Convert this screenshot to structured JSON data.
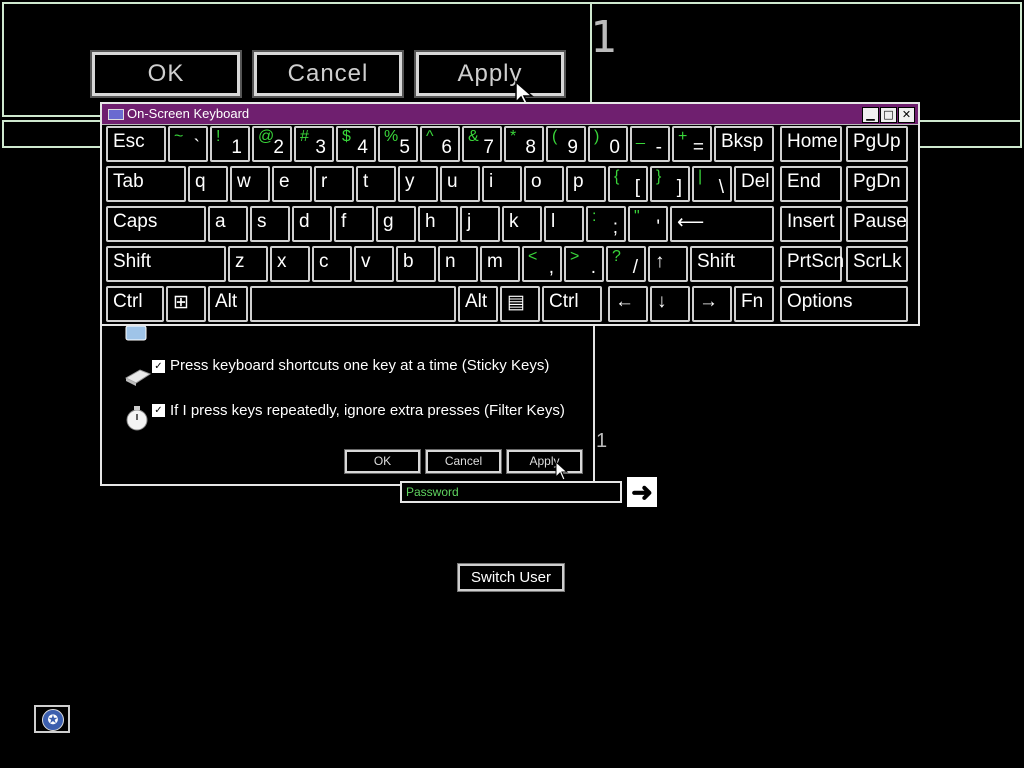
{
  "magnified_dialog": {
    "ok_label": "OK",
    "cancel_label": "Cancel",
    "apply_label": "Apply",
    "digit": "1"
  },
  "osk": {
    "title": "On-Screen Keyboard",
    "minimize": "▁",
    "maximize": "□",
    "close": "✕",
    "rows": [
      [
        {
          "label": "Esc"
        },
        {
          "shift": "~",
          "base": "`"
        },
        {
          "shift": "!",
          "base": "1"
        },
        {
          "shift": "@",
          "base": "2"
        },
        {
          "shift": "#",
          "base": "3"
        },
        {
          "shift": "$",
          "base": "4"
        },
        {
          "shift": "%",
          "base": "5"
        },
        {
          "shift": "^",
          "base": "6"
        },
        {
          "shift": "&",
          "base": "7"
        },
        {
          "shift": "*",
          "base": "8"
        },
        {
          "shift": "(",
          "base": "9"
        },
        {
          "shift": ")",
          "base": "0"
        },
        {
          "shift": "_",
          "base": "-"
        },
        {
          "shift": "+",
          "base": "="
        },
        {
          "label": "Bksp"
        },
        {
          "label": "Home"
        },
        {
          "label": "PgUp"
        }
      ],
      [
        {
          "label": "Tab"
        },
        {
          "label": "q"
        },
        {
          "label": "w"
        },
        {
          "label": "e"
        },
        {
          "label": "r"
        },
        {
          "label": "t"
        },
        {
          "label": "y"
        },
        {
          "label": "u"
        },
        {
          "label": "i"
        },
        {
          "label": "o"
        },
        {
          "label": "p"
        },
        {
          "shift": "{",
          "base": "["
        },
        {
          "shift": "}",
          "base": "]"
        },
        {
          "shift": "|",
          "base": "\\"
        },
        {
          "label": "Del"
        },
        {
          "label": "End"
        },
        {
          "label": "PgDn"
        }
      ],
      [
        {
          "label": "Caps"
        },
        {
          "label": "a"
        },
        {
          "label": "s"
        },
        {
          "label": "d"
        },
        {
          "label": "f"
        },
        {
          "label": "g"
        },
        {
          "label": "h"
        },
        {
          "label": "j"
        },
        {
          "label": "k"
        },
        {
          "label": "l"
        },
        {
          "shift": ":",
          "base": ";"
        },
        {
          "shift": "\"",
          "base": "'"
        },
        {
          "label": "⟵"
        },
        {
          "label": "Insert"
        },
        {
          "label": "Pause"
        }
      ],
      [
        {
          "label": "Shift"
        },
        {
          "label": "z"
        },
        {
          "label": "x"
        },
        {
          "label": "c"
        },
        {
          "label": "v"
        },
        {
          "label": "b"
        },
        {
          "label": "n"
        },
        {
          "label": "m"
        },
        {
          "shift": "<",
          "base": ","
        },
        {
          "shift": ">",
          "base": "."
        },
        {
          "shift": "?",
          "base": "/"
        },
        {
          "label": "↑"
        },
        {
          "label": "Shift"
        },
        {
          "label": "PrtScn"
        },
        {
          "label": "ScrLk"
        }
      ],
      [
        {
          "label": "Ctrl"
        },
        {
          "label": "⊞"
        },
        {
          "label": "Alt"
        },
        {
          "label": ""
        },
        {
          "label": "Alt"
        },
        {
          "label": "▤"
        },
        {
          "label": "Ctrl"
        },
        {
          "label": "←"
        },
        {
          "label": "↓"
        },
        {
          "label": "→"
        },
        {
          "label": "Fn"
        },
        {
          "label": "Options"
        }
      ]
    ]
  },
  "ease_dialog": {
    "sticky_keys": "Press keyboard shortcuts one key at a time (Sticky Keys)",
    "filter_keys": "If I press keys repeatedly, ignore extra presses (Filter Keys)",
    "ok_label": "OK",
    "cancel_label": "Cancel",
    "apply_label": "Apply",
    "digit": "1"
  },
  "login": {
    "password_placeholder": "Password",
    "submit_icon": "arrow-right-icon",
    "switch_user_label": "Switch User"
  }
}
